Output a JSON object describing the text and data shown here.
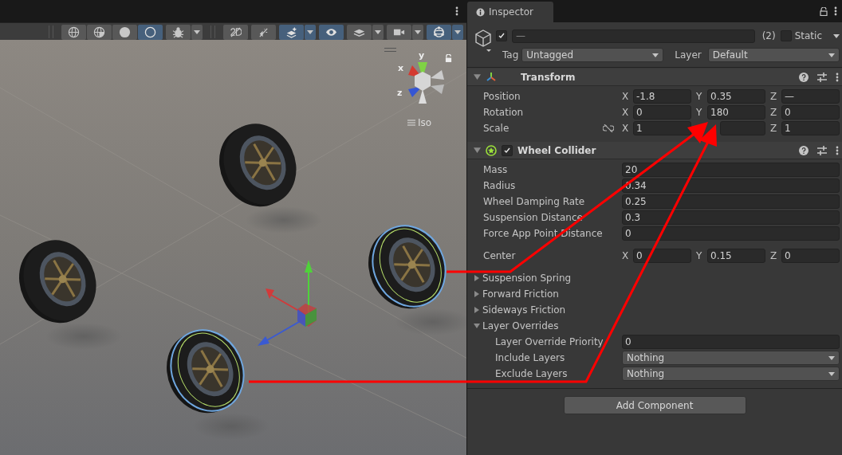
{
  "scene": {
    "toolbar": [
      {
        "selected": false,
        "dropdown": false
      },
      {
        "selected": false,
        "dropdown": false
      },
      {
        "selected": false,
        "dropdown": false
      },
      {
        "selected": true,
        "dropdown": false
      },
      {
        "selected": false,
        "dropdown": true
      },
      {
        "selected": false,
        "dropdown": false
      },
      {
        "selected": false,
        "dropdown": false
      },
      {
        "selected": true,
        "dropdown": true
      },
      {
        "selected": true,
        "dropdown": false
      },
      {
        "selected": false,
        "dropdown": true
      },
      {
        "selected": false,
        "dropdown": true
      },
      {
        "selected": true,
        "dropdown": true
      }
    ],
    "wheels": [
      {
        "selected": false
      },
      {
        "selected": false
      },
      {
        "selected": true
      },
      {
        "selected": true
      }
    ],
    "orientation_gizmo": {
      "axis_labels": [
        "x",
        "y",
        "z"
      ],
      "projection": "Iso"
    }
  },
  "inspector": {
    "tab": "Inspector",
    "object": {
      "active": true,
      "name": "—",
      "count": "(2)",
      "static": false,
      "static_label": "Static",
      "tag_label": "Tag",
      "tag": "Untagged",
      "layer_label": "Layer",
      "layer": "Default"
    },
    "components": [
      {
        "kind": "transform",
        "title": "Transform",
        "expanded": true,
        "rows": [
          {
            "kind": "vector3",
            "label": "Position",
            "values": [
              {
                "axis": "X",
                "value": "-1.8"
              },
              {
                "axis": "Y",
                "value": "0.35"
              },
              {
                "axis": "Z",
                "value": "—"
              }
            ]
          },
          {
            "kind": "vector3",
            "label": "Rotation",
            "values": [
              {
                "axis": "X",
                "value": "0"
              },
              {
                "axis": "Y",
                "value": "180"
              },
              {
                "axis": "Z",
                "value": "0"
              }
            ]
          },
          {
            "kind": "vector3",
            "label": "Scale",
            "linked": false,
            "values": [
              {
                "axis": "X",
                "value": "1"
              },
              {
                "covered": true
              },
              {
                "axis": "Z",
                "value": "1"
              }
            ]
          }
        ]
      },
      {
        "kind": "wheel",
        "title": "Wheel Collider",
        "expanded": true,
        "enabled": true,
        "rows": [
          {
            "kind": "number",
            "label": "Mass",
            "value": "20"
          },
          {
            "kind": "number",
            "label": "Radius",
            "value": "0.34"
          },
          {
            "kind": "number",
            "label": "Wheel Damping Rate",
            "value": "0.25"
          },
          {
            "kind": "number",
            "label": "Suspension Distance",
            "value": "0.3"
          },
          {
            "kind": "number",
            "label": "Force App Point Distance",
            "value": "0"
          },
          {
            "kind": "vector3",
            "label": "Center",
            "gap": true,
            "values": [
              {
                "axis": "X",
                "value": "0"
              },
              {
                "axis": "Y",
                "value": "0.15"
              },
              {
                "axis": "Z",
                "value": "0"
              }
            ]
          },
          {
            "kind": "foldout",
            "label": "Suspension Spring",
            "expanded": false
          },
          {
            "kind": "foldout",
            "label": "Forward Friction",
            "expanded": false
          },
          {
            "kind": "foldout",
            "label": "Sideways Friction",
            "expanded": false
          },
          {
            "kind": "foldout",
            "label": "Layer Overrides",
            "expanded": true,
            "children": [
              {
                "kind": "number",
                "label": "Layer Override Priority",
                "value": "0"
              },
              {
                "kind": "dropdown",
                "label": "Include Layers",
                "value": "Nothing"
              },
              {
                "kind": "dropdown",
                "label": "Exclude Layers",
                "value": "Nothing"
              }
            ]
          }
        ]
      }
    ],
    "add_button": "Add Component"
  }
}
